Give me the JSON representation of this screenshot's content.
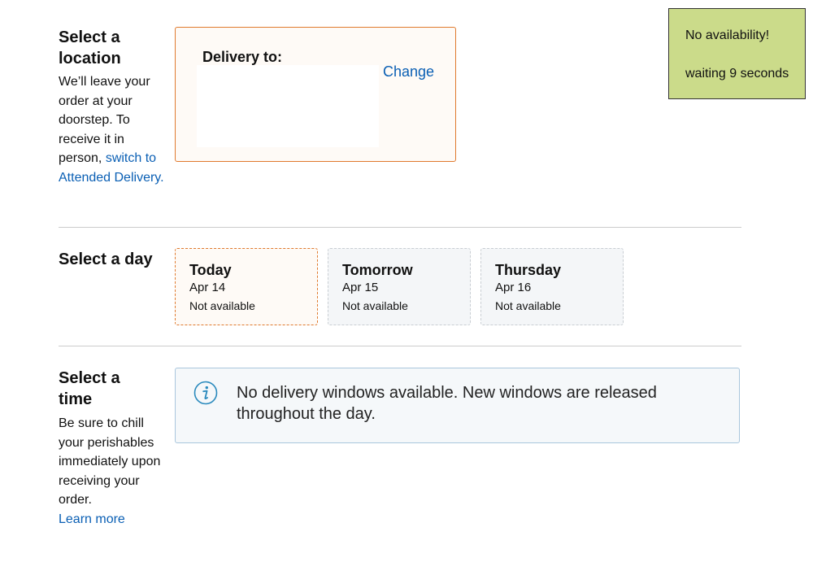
{
  "location": {
    "title": "Select a location",
    "desc_prefix": "We’ll leave your order at your doorstep. To receive it in person, ",
    "desc_link": "switch to Attended Delivery.",
    "card": {
      "label": "Delivery to:",
      "change": "Change"
    }
  },
  "day": {
    "title": "Select a day",
    "options": [
      {
        "name": "Today",
        "date": "Apr 14",
        "status": "Not available",
        "selected": true
      },
      {
        "name": "Tomorrow",
        "date": "Apr 15",
        "status": "Not available",
        "selected": false
      },
      {
        "name": "Thursday",
        "date": "Apr 16",
        "status": "Not available",
        "selected": false
      }
    ]
  },
  "time": {
    "title": "Select a time",
    "desc": "Be sure to chill your perishables immediately upon receiving your order.",
    "link": "Learn more",
    "info": "No delivery windows available. New windows are released throughout the day.",
    "icon": "info-icon"
  },
  "notification": {
    "line1": "No availability!",
    "line2": "waiting 9 seconds"
  },
  "colors": {
    "accent": "#e07a2e",
    "link": "#0a5fb4",
    "notify_bg": "#cbdb8a",
    "info_border": "#a9c6dd"
  }
}
